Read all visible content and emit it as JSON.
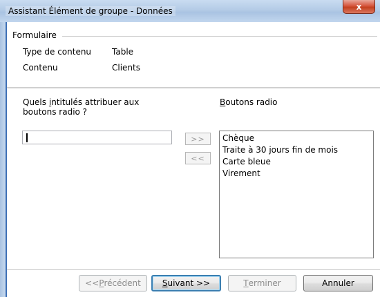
{
  "window": {
    "title": "Assistant Élément de groupe - Données",
    "close_glyph": "x"
  },
  "form_group": {
    "legend": "Formulaire",
    "rows": [
      {
        "label": "Type de contenu",
        "value": "Table"
      },
      {
        "label": "Contenu",
        "value": "Clients"
      }
    ]
  },
  "question": {
    "pre": "Quels ",
    "mnemonic": "i",
    "post": "ntitulés attribuer aux boutons radio ?"
  },
  "label_input": {
    "value": ""
  },
  "add_button": {
    "label": ">>"
  },
  "remove_button": {
    "label": "<<"
  },
  "radio_list": {
    "title_mnemonic": "B",
    "title_rest": "outons radio",
    "items": [
      "Chèque",
      "Traite à 30 jours fin de mois",
      "Carte bleue",
      "Virement"
    ]
  },
  "buttons": {
    "previous": {
      "pre": "<< ",
      "mnemonic": "P",
      "post": "récédent"
    },
    "next": {
      "pre": "",
      "mnemonic": "S",
      "post": "uivant >>"
    },
    "finish": {
      "pre": "",
      "mnemonic": "T",
      "post": "erminer"
    },
    "cancel": {
      "label": "Annuler"
    }
  }
}
